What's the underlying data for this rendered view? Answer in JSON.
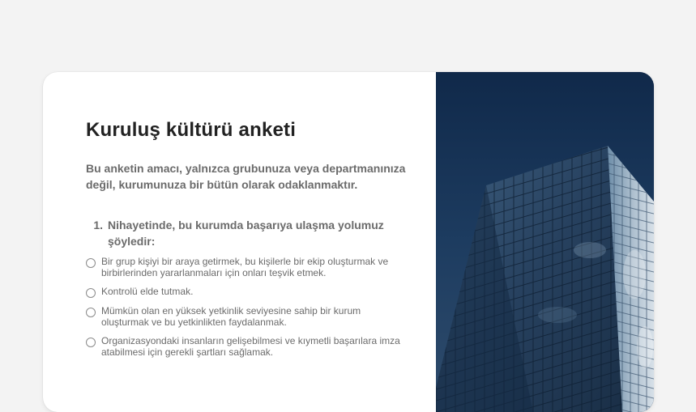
{
  "survey": {
    "title": "Kuruluş kültürü anketi",
    "intro": "Bu anketin amacı, yalnızca grubunuza veya departmanınıza değil, kurumunuza bir bütün olarak odaklanmaktır.",
    "question": {
      "number": "1.",
      "text": "Nihayetinde, bu kurumda başarıya ulaşma yolumuz şöyledir:",
      "options": [
        "Bir grup kişiyi bir araya getirmek, bu kişilerle bir ekip oluşturmak ve birbirlerinden yararlanmaları için onları teşvik etmek.",
        "Kontrolü elde tutmak.",
        "Mümkün olan en yüksek yetkinlik seviyesine sahip bir kurum oluşturmak ve bu yetkinlikten faydalanmak.",
        "Organizasyondaki insanların gelişebilmesi ve kıymetli başarılara imza atabilmesi için gerekli şartları sağlamak."
      ]
    }
  },
  "image": {
    "subject": "glass-skyscraper-photo",
    "sky_color": "#1b3a5d",
    "glass_color": "#4a6e8e"
  }
}
